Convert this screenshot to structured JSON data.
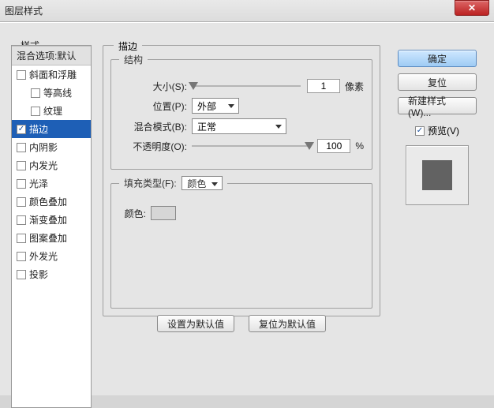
{
  "window": {
    "title": "图层样式"
  },
  "styles": {
    "header": "样式",
    "blend": "混合选项:默认",
    "items": [
      {
        "label": "斜面和浮雕",
        "checked": false
      },
      {
        "label": "等高线",
        "checked": false,
        "sub": true
      },
      {
        "label": "纹理",
        "checked": false,
        "sub": true
      },
      {
        "label": "描边",
        "checked": true,
        "selected": true
      },
      {
        "label": "内阴影",
        "checked": false
      },
      {
        "label": "内发光",
        "checked": false
      },
      {
        "label": "光泽",
        "checked": false
      },
      {
        "label": "颜色叠加",
        "checked": false
      },
      {
        "label": "渐变叠加",
        "checked": false
      },
      {
        "label": "图案叠加",
        "checked": false
      },
      {
        "label": "外发光",
        "checked": false
      },
      {
        "label": "投影",
        "checked": false
      }
    ]
  },
  "stroke": {
    "panel_title": "描边",
    "structure_title": "结构",
    "size_label": "大小(S):",
    "size_value": "1",
    "size_unit": "像素",
    "position_label": "位置(P):",
    "position_value": "外部",
    "blend_label": "混合模式(B):",
    "blend_value": "正常",
    "opacity_label": "不透明度(O):",
    "opacity_value": "100",
    "opacity_unit": "%",
    "fill_title": "填充类型(F):",
    "fill_value": "颜色",
    "color_label": "颜色:",
    "set_default": "设置为默认值",
    "reset_default": "复位为默认值"
  },
  "right": {
    "ok": "确定",
    "cancel": "复位",
    "new_style": "新建样式(W)...",
    "preview": "预览(V)"
  }
}
